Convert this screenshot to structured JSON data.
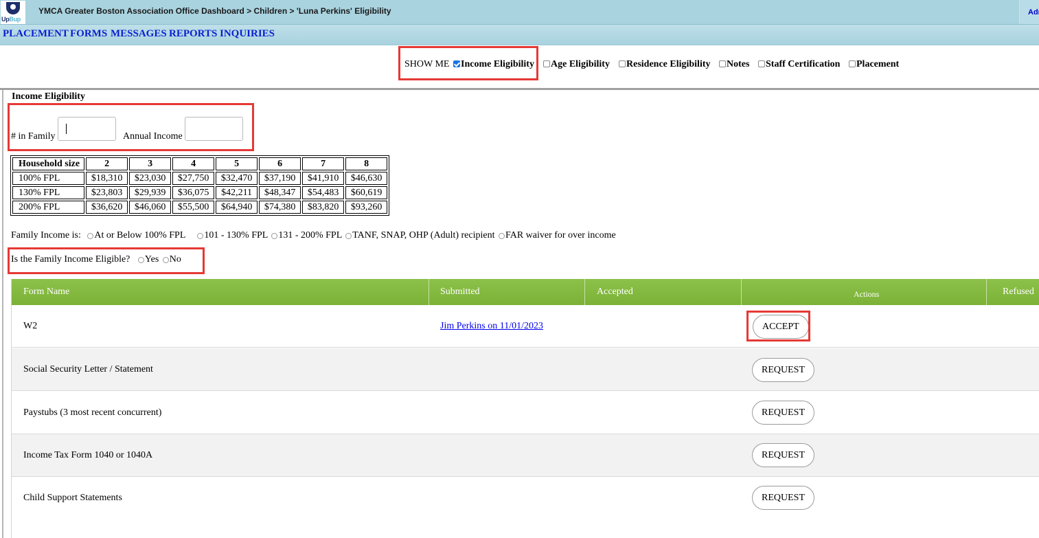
{
  "header": {
    "logo_text_a": "Up",
    "logo_text_b": "Bup",
    "breadcrumb": "YMCA Greater Boston Association Office Dashboard > Children > 'Luna Perkins' Eligibility",
    "admin_link": "Adm"
  },
  "nav": [
    "PLACEMENT",
    "FORMS",
    "MESSAGES",
    "REPORTS",
    "INQUIRIES"
  ],
  "show_me": {
    "label": "SHOW ME",
    "options": [
      {
        "label": "Income Eligibility",
        "checked": true
      },
      {
        "label": "Age Eligibility",
        "checked": false
      },
      {
        "label": "Residence Eligibility",
        "checked": false
      },
      {
        "label": "Notes",
        "checked": false
      },
      {
        "label": "Staff Certification",
        "checked": false
      },
      {
        "label": "Placement",
        "checked": false
      }
    ]
  },
  "income": {
    "title": "Income Eligibility",
    "family_label": "# in Family",
    "family_value": "",
    "annual_label": "Annual Income",
    "annual_value": ""
  },
  "fpl_table": {
    "header": [
      "Household size",
      "2",
      "3",
      "4",
      "5",
      "6",
      "7",
      "8"
    ],
    "rows": [
      [
        "100% FPL",
        "$18,310",
        "$23,030",
        "$27,750",
        "$32,470",
        "$37,190",
        "$41,910",
        "$46,630"
      ],
      [
        "130% FPL",
        "$23,803",
        "$29,939",
        "$36,075",
        "$42,211",
        "$48,347",
        "$54,483",
        "$60,619"
      ],
      [
        "200% FPL",
        "$36,620",
        "$46,060",
        "$55,500",
        "$64,940",
        "$74,380",
        "$83,820",
        "$93,260"
      ]
    ]
  },
  "family_income": {
    "label": "Family Income is:",
    "options": [
      "At or Below 100% FPL",
      "101 - 130% FPL",
      "131 - 200% FPL",
      "TANF, SNAP, OHP (Adult) recipient",
      "FAR waiver for over income"
    ]
  },
  "eligible": {
    "question": "Is the Family Income Eligible?",
    "yes": "Yes",
    "no": "No"
  },
  "forms": {
    "columns": {
      "form_name": "Form Name",
      "submitted": "Submitted",
      "accepted": "Accepted",
      "actions": "Actions",
      "refused": "Refused"
    },
    "rows": [
      {
        "name": "W2",
        "submitted": "Jim Perkins on 11/01/2023",
        "action": "ACCEPT"
      },
      {
        "name": "Social Security Letter / Statement",
        "submitted": "",
        "action": "REQUEST"
      },
      {
        "name": "Paystubs (3 most recent concurrent)",
        "submitted": "",
        "action": "REQUEST"
      },
      {
        "name": "Income Tax Form 1040 or 1040A",
        "submitted": "",
        "action": "REQUEST"
      },
      {
        "name": "Child Support Statements",
        "submitted": "",
        "action": "REQUEST"
      }
    ]
  },
  "colors": {
    "header_bg": "#a9d3df",
    "nav_link": "#0a1fd0",
    "table_header_green": "#7ab236",
    "highlight_red": "#e53935"
  }
}
